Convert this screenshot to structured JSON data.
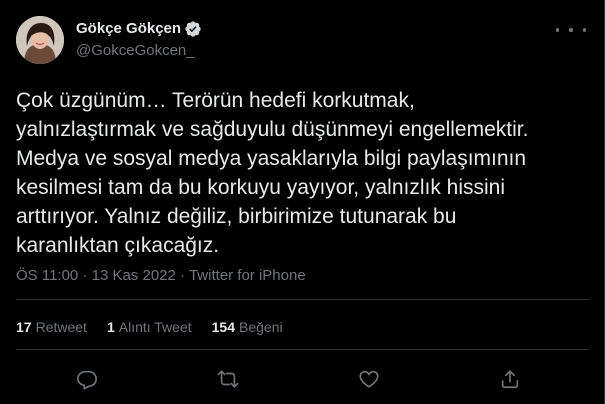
{
  "author": {
    "display_name": "Gökçe Gökçen",
    "handle": "@GokceGokcen_",
    "verified": true
  },
  "tweet": {
    "text": "Çok üzgünüm… Terörün hedefi korkutmak,\nyalnızlaştırmak ve sağduyulu düşünmeyi engellemektir.\nMedya ve sosyal medya yasaklarıyla bilgi paylaşımının\nkesilmesi tam da bu korkuyu yayıyor, yalnızlık hissini\narttırıyor. Yalnız değiliz, birbirimize tutunarak bu\nkaranlıktan çıkacağız.",
    "time": "ÖS 11:00",
    "separator": "·",
    "date": "13 Kas 2022",
    "source": "Twitter for iPhone"
  },
  "stats": {
    "retweets_count": "17",
    "retweets_label": "Retweet",
    "quotes_count": "1",
    "quotes_label": "Alıntı Tweet",
    "likes_count": "154",
    "likes_label": "Beğeni"
  },
  "icons": {
    "verified": "verified-badge-icon",
    "more": "more-dots-icon",
    "reply": "reply-icon",
    "retweet": "retweet-icon",
    "like": "heart-icon",
    "share": "share-icon"
  },
  "colors": {
    "background": "#000000",
    "text": "#e7e9ea",
    "secondary": "#71767b",
    "divider": "#2f3336"
  }
}
